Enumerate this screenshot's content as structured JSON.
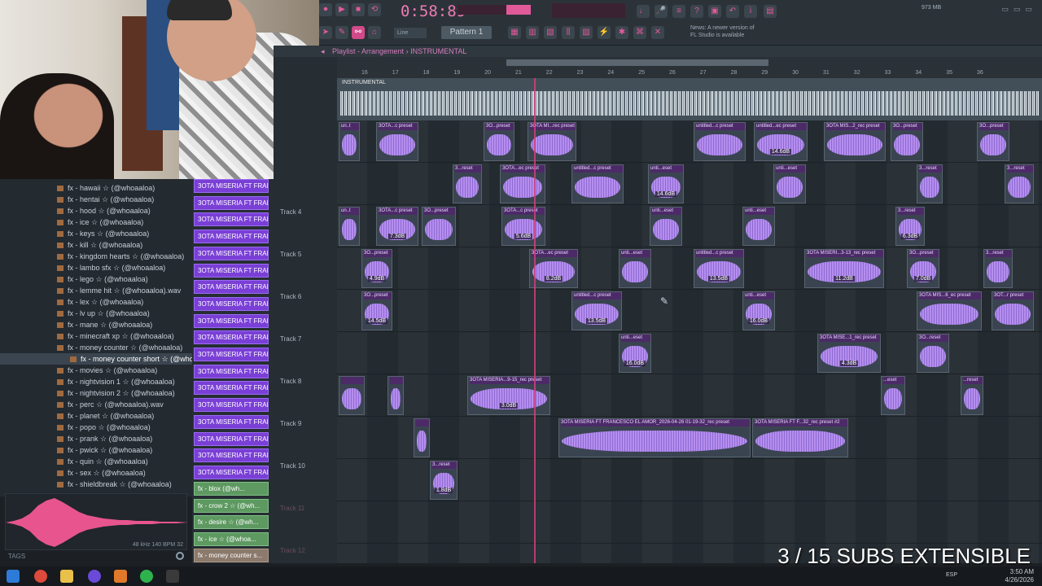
{
  "toolbar": {
    "time": "0:58:89",
    "pattern": "Pattern 1",
    "snap": "Line",
    "cpu": "973 MB",
    "news": "FL Studio is available",
    "news_prefix": "News: A newer version of"
  },
  "playlist": {
    "title": "Playlist - Arrangement",
    "sep": "›",
    "arrangement": "INSTRUMENTAL",
    "ruler": [
      "16",
      "17",
      "18",
      "19",
      "20",
      "21",
      "22",
      "23",
      "24",
      "25",
      "26",
      "27",
      "28",
      "29",
      "30",
      "31",
      "32",
      "33",
      "34",
      "35",
      "36"
    ],
    "instrumental_clip": "INSTRUMENTAL",
    "tracks": [
      {
        "label": ""
      },
      {
        "label": ""
      },
      {
        "label": ""
      },
      {
        "label": "Track 4"
      },
      {
        "label": "Track 5"
      },
      {
        "label": "Track 6"
      },
      {
        "label": "Track 7"
      },
      {
        "label": "Track 8"
      },
      {
        "label": "Track 9"
      },
      {
        "label": "Track 10"
      },
      {
        "label": "Track 11"
      },
      {
        "label": "Track 12"
      }
    ],
    "clips": [
      {
        "lane": 1,
        "name": "un..t",
        "db": ""
      },
      {
        "lane": 1,
        "name": "3OTA...c preset",
        "db": ""
      },
      {
        "lane": 1,
        "name": "3O...preset",
        "db": ""
      },
      {
        "lane": 1,
        "name": "3OTA MI...rec preset",
        "db": ""
      },
      {
        "lane": 1,
        "name": "untitled...c preset",
        "db": ""
      },
      {
        "lane": 1,
        "name": "untitled...ec preset",
        "db": "14.6dB"
      },
      {
        "lane": 1,
        "name": "3OTA MIS...2_rec preset",
        "db": ""
      },
      {
        "lane": 1,
        "name": "3O...preset",
        "db": ""
      },
      {
        "lane": 1,
        "name": "3O...preset",
        "db": ""
      },
      {
        "lane": 2,
        "name": "3...reset",
        "db": ""
      },
      {
        "lane": 2,
        "name": "3OTA...ec preset",
        "db": ""
      },
      {
        "lane": 2,
        "name": "untitled...c preset",
        "db": ""
      },
      {
        "lane": 2,
        "name": "unti...eset",
        "db": "14.6dB"
      },
      {
        "lane": 2,
        "name": "unti...eset",
        "db": ""
      },
      {
        "lane": 2,
        "name": "3...reset",
        "db": ""
      },
      {
        "lane": 2,
        "name": "3...reset",
        "db": ""
      },
      {
        "lane": 3,
        "name": "un..t",
        "db": ""
      },
      {
        "lane": 3,
        "name": "3OTA...c preset",
        "db": "7.3dB"
      },
      {
        "lane": 3,
        "name": "3O...preset",
        "db": ""
      },
      {
        "lane": 3,
        "name": "3OTA...c preset",
        "db": "5.6dB"
      },
      {
        "lane": 3,
        "name": "unti...eset",
        "db": ""
      },
      {
        "lane": 3,
        "name": "unti...eset",
        "db": ""
      },
      {
        "lane": 3,
        "name": "3...reset",
        "db": "6.3dB"
      },
      {
        "lane": 4,
        "name": "3O...preset",
        "db": "4.9dB"
      },
      {
        "lane": 4,
        "name": "3OTA...ec preset",
        "db": "8.2dB"
      },
      {
        "lane": 4,
        "name": "unti...eset",
        "db": ""
      },
      {
        "lane": 4,
        "name": "untitled...c preset",
        "db": "13.5dB"
      },
      {
        "lane": 4,
        "name": "3OTA MISERI...3-13_rec preset",
        "db": "11.2dB"
      },
      {
        "lane": 4,
        "name": "3O...preset",
        "db": "7.0dB"
      },
      {
        "lane": 4,
        "name": "3...reset",
        "db": ""
      },
      {
        "lane": 5,
        "name": "3O...preset",
        "db": "14.5dB"
      },
      {
        "lane": 5,
        "name": "untitled...c preset",
        "db": "13.5dB"
      },
      {
        "lane": 5,
        "name": "unti...eset",
        "db": "16.0dB"
      },
      {
        "lane": 5,
        "name": "3OTA MIS...6_ec preset",
        "db": ""
      },
      {
        "lane": 5,
        "name": "3OT...r preset",
        "db": ""
      },
      {
        "lane": 6,
        "name": "unti...eset",
        "db": "16.0dB"
      },
      {
        "lane": 6,
        "name": "3OTA MISE...1_rec preset",
        "db": "4.3dB"
      },
      {
        "lane": 6,
        "name": "3O...reset",
        "db": ""
      },
      {
        "lane": 7,
        "name": "",
        "db": ""
      },
      {
        "lane": 7,
        "name": "",
        "db": ""
      },
      {
        "lane": 7,
        "name": "3OTA MISERIA...9-15_rec preset",
        "db": "3.0dB"
      },
      {
        "lane": 7,
        "name": "...eset",
        "db": ""
      },
      {
        "lane": 7,
        "name": "...reset",
        "db": ""
      },
      {
        "lane": 8,
        "name": "",
        "db": ""
      },
      {
        "lane": 8,
        "name": "3OTA MISERIA FT FRANCESCO EL AMOR_2026-04-26 01-19-32_rec preset",
        "db": ""
      },
      {
        "lane": 8,
        "name": "3OTA MISERIA FT F...32_rec preset #2",
        "db": ""
      },
      {
        "lane": 9,
        "name": "3...reset",
        "db": "1.8dB"
      }
    ]
  },
  "browser": {
    "items": [
      "fx - hawaii ☆ (@whoaaloa)",
      "fx - hentai ☆ (@whoaaloa)",
      "fx - hood ☆ (@whoaaloa)",
      "fx - ice ☆ (@whoaaloa)",
      "fx - keys ☆ (@whoaaloa)",
      "fx - kill ☆ (@whoaaloa)",
      "fx - kingdom hearts ☆ (@whoaaloa)",
      "fx - lambo sfx ☆ (@whoaaloa)",
      "fx - lego ☆ (@whoaaloa)",
      "fx - lemme hit ☆ (@whoaaloa).wav",
      "fx - lex ☆ (@whoaaloa)",
      "fx - lv up ☆ (@whoaaloa)",
      "fx - mane ☆ (@whoaaloa)",
      "fx - minecraft xp ☆ (@whoaaloa)",
      "fx - money counter ☆ (@whoaaloa)",
      "fx - money counter short ☆ (@whoaaloa)",
      "fx - movies ☆ (@whoaaloa)",
      "fx - nightvision 1 ☆ (@whoaaloa)",
      "fx - nightvision 2 ☆ (@whoaaloa)",
      "fx - perc ☆ (@whoaaloa).wav",
      "fx - planet ☆ (@whoaaloa)",
      "fx - popo ☆ (@whoaaloa)",
      "fx - prank ☆ (@whoaaloa)",
      "fx - pwick ☆ (@whoaaloa)",
      "fx - quin ☆ (@whoaaloa)",
      "fx - sex ☆ (@whoaaloa)",
      "fx - shieldbreak ☆ (@whoaaloa)"
    ],
    "selected_index": 15,
    "sample_rate": "48 kHz 140 BPM 32",
    "tags": "TAGS"
  },
  "channels": {
    "items": [
      "3OTA MISERIA FT FRANCH...",
      "3OTA MISERIA FT FRANCH...",
      "3OTA MISERIA FT FRANCH...",
      "3OTA MISERIA FT FRANCH...",
      "3OTA MISERIA FT FRANCH...",
      "3OTA MISERIA FT FRANCH...",
      "3OTA MISERIA FT FRANCH...",
      "3OTA MISERIA FT FRANCH...",
      "3OTA MISERIA FT FRANCH...",
      "3OTA MISERIA FT FRANCH...",
      "3OTA MISERIA FT FRANCH...",
      "3OTA MISERIA FT FRANCH...",
      "3OTA MISERIA FT FRANCH...",
      "3OTA MISERIA FT FRANCH...",
      "3OTA MISERIA FT FRANCH...",
      "3OTA MISERIA FT FRANCH...",
      "3OTA MISERIA FT FRANCH...",
      "3OTA MISERIA FT FRANCH..."
    ],
    "fx_items": [
      "fx - blox (@wh...",
      "fx - crow 2 ☆ (@wh...",
      "fx - desire ☆ (@wh...",
      "fx - ice ☆ (@whoa...",
      "fx - money counter s..."
    ]
  },
  "overlay_text": "3 / 15 SUBS EXTENSIBLE",
  "taskbar": {
    "time": "3:50 AM",
    "date": "4/26/2026",
    "lang": "ESP"
  },
  "colors": {
    "accent": "#e05a9a",
    "clip": "#a57ee8",
    "channel": "#7a3fd6"
  }
}
